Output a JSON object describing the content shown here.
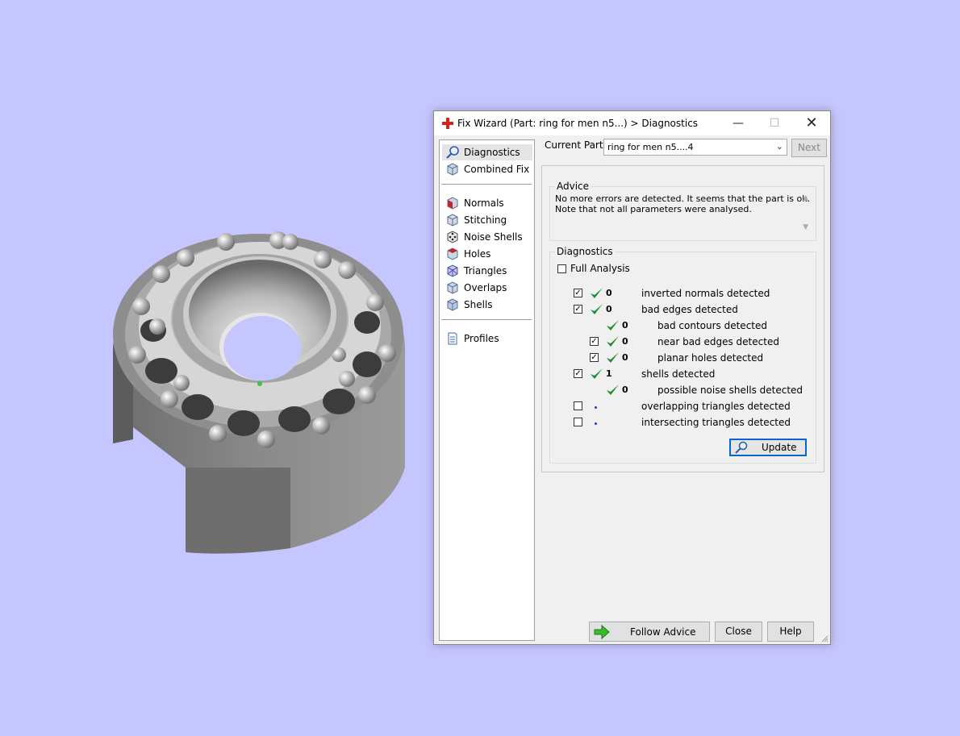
{
  "model": {
    "name": "ring-bearing-3d-model"
  },
  "window": {
    "title": "Fix Wizard (Part: ring for men n5...) > Diagnostics",
    "icons": {
      "app": "red-cross-icon",
      "minimize": "minimize-icon",
      "maximize": "maximize-icon",
      "close": "close-icon"
    }
  },
  "sidebar": {
    "items": [
      {
        "label": "Diagnostics",
        "icon": "magnifier-icon",
        "selected": true
      },
      {
        "label": "Combined Fix",
        "icon": "cube-icon"
      },
      {
        "label": "Normals",
        "icon": "normals-cube-icon"
      },
      {
        "label": "Stitching",
        "icon": "stitching-cube-icon"
      },
      {
        "label": "Noise Shells",
        "icon": "noise-shells-cube-icon"
      },
      {
        "label": "Holes",
        "icon": "holes-cube-icon"
      },
      {
        "label": "Triangles",
        "icon": "triangles-cube-icon"
      },
      {
        "label": "Overlaps",
        "icon": "overlaps-cube-icon"
      },
      {
        "label": "Shells",
        "icon": "shells-cube-icon"
      },
      {
        "label": "Profiles",
        "icon": "document-icon"
      }
    ]
  },
  "current_part": {
    "label": "Current Part:",
    "value": "ring for men n5....4",
    "next_label": "Next"
  },
  "advice": {
    "title": "Advice",
    "line1": "No more errors are detected. It seems that the part is ok.",
    "line2": "Note that not all parameters were analysed."
  },
  "diagnostics": {
    "title": "Diagnostics",
    "full_analysis_label": "Full Analysis",
    "full_analysis_checked": false,
    "rows": [
      {
        "checkbox": true,
        "checked": true,
        "status": "ok",
        "count": "0",
        "label": "inverted normals detected",
        "indent": 0
      },
      {
        "checkbox": true,
        "checked": true,
        "status": "ok",
        "count": "0",
        "label": "bad edges detected",
        "indent": 0
      },
      {
        "checkbox": false,
        "checked": false,
        "status": "ok",
        "count": "0",
        "label": "bad contours detected",
        "indent": 1
      },
      {
        "checkbox": true,
        "checked": true,
        "status": "ok",
        "count": "0",
        "label": "near bad edges detected",
        "indent": 1
      },
      {
        "checkbox": true,
        "checked": true,
        "status": "ok",
        "count": "0",
        "label": "planar holes detected",
        "indent": 1
      },
      {
        "checkbox": true,
        "checked": true,
        "status": "ok",
        "count": "1",
        "label": "shells detected",
        "indent": 0
      },
      {
        "checkbox": false,
        "checked": false,
        "status": "ok",
        "count": "0",
        "label": "possible noise shells detected",
        "indent": 1
      },
      {
        "checkbox": true,
        "checked": false,
        "status": "none",
        "count": "",
        "label": "overlapping triangles detected",
        "indent": 0
      },
      {
        "checkbox": true,
        "checked": false,
        "status": "none",
        "count": "",
        "label": "intersecting triangles detected",
        "indent": 0
      }
    ],
    "update_label": "Update",
    "update_icon": "magnifier-icon"
  },
  "footer": {
    "follow_label": "Follow Advice",
    "follow_icon": "green-arrow-icon",
    "close_label": "Close",
    "help_label": "Help"
  },
  "colors": {
    "background": "#c6c6fe",
    "check": "#1e8a2e",
    "focus": "#0a64d0"
  }
}
